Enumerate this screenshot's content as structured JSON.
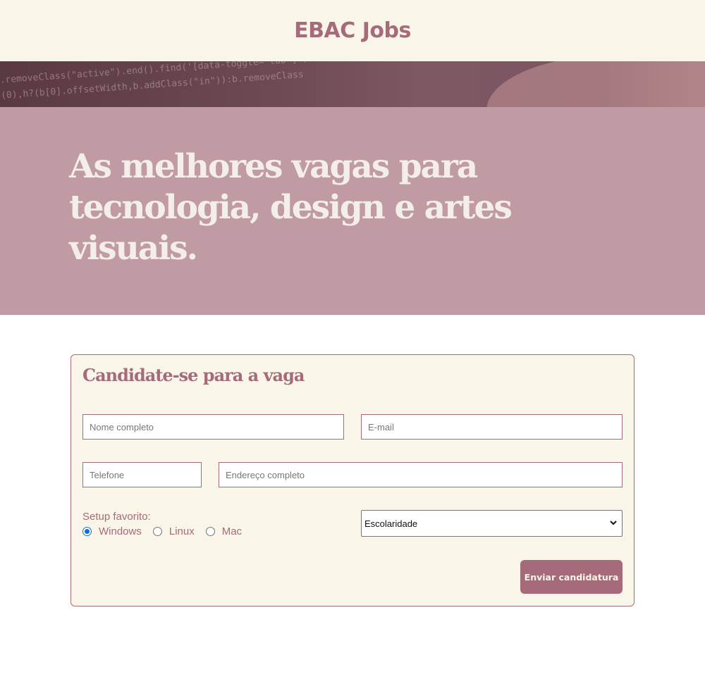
{
  "header": {
    "brand": "EBAC Jobs"
  },
  "hero": {
    "code_lines": [
      ".removeClass(\"active\").end().find('[data-toggle=\"tab\"]')",
      "(0),h?(b[0].offsetWidth,b.addClass(\"in\")):b.removeClass"
    ],
    "title": "As melhores vagas para tecnologia, design e artes visuais."
  },
  "form": {
    "title": "Candidate-se para a vaga",
    "fields": {
      "nome": {
        "placeholder": "Nome completo"
      },
      "email": {
        "placeholder": "E-mail"
      },
      "telefone": {
        "placeholder": "Telefone"
      },
      "endereco": {
        "placeholder": "Endereço completo"
      }
    },
    "setup_label": "Setup favorito:",
    "setup_options": [
      {
        "label": "Windows",
        "checked": true
      },
      {
        "label": "Linux",
        "checked": false
      },
      {
        "label": "Mac",
        "checked": false
      }
    ],
    "escolaridade": {
      "selected": "Escolaridade"
    },
    "submit_label": "Enviar candidatura"
  },
  "colors": {
    "brand": "#a56b7b",
    "cream": "#f9f5e8",
    "hero_bg": "#c19ba3",
    "radio_checked": "#0b6ee0"
  }
}
